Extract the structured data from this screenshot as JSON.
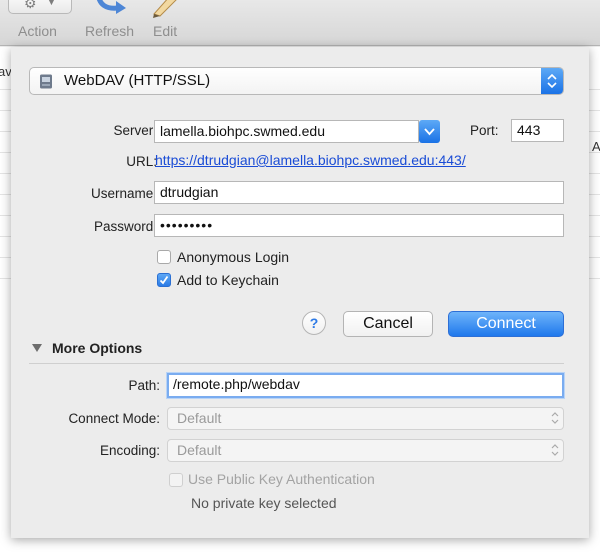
{
  "toolbar": {
    "action_label": "Action",
    "refresh_label": "Refresh",
    "edit_label": "Edit"
  },
  "background": {
    "left_fragment": "av",
    "right_fragment": "A"
  },
  "connection": {
    "protocol": "WebDAV (HTTP/SSL)",
    "server_label": "Server:",
    "server_value": "lamella.biohpc.swmed.edu",
    "port_label": "Port:",
    "port_value": "443",
    "url_label": "URL:",
    "url_value": "https://dtrudgian@lamella.biohpc.swmed.edu:443/",
    "username_label": "Username:",
    "username_value": "dtrudgian",
    "password_label": "Password:",
    "password_value": "•••••••••",
    "anonymous_label": "Anonymous Login",
    "anonymous_checked": false,
    "keychain_label": "Add to Keychain",
    "keychain_checked": true
  },
  "buttons": {
    "help": "?",
    "cancel": "Cancel",
    "connect": "Connect"
  },
  "more_options": {
    "title": "More Options",
    "path_label": "Path:",
    "path_value": "/remote.php/webdav",
    "connect_mode_label": "Connect Mode:",
    "connect_mode_value": "Default",
    "encoding_label": "Encoding:",
    "encoding_value": "Default",
    "pubkey_label": "Use Public Key Authentication",
    "private_key_status": "No private key selected"
  },
  "colors": {
    "accent": "#1f78ec",
    "link": "#1a4cd6"
  },
  "icons": {
    "action": "gear-icon",
    "refresh": "refresh-arrow-icon",
    "edit": "pencil-icon",
    "protocol": "disk-icon",
    "server_combo": "chevron-down-icon",
    "disclosure": "triangle-down-icon"
  }
}
